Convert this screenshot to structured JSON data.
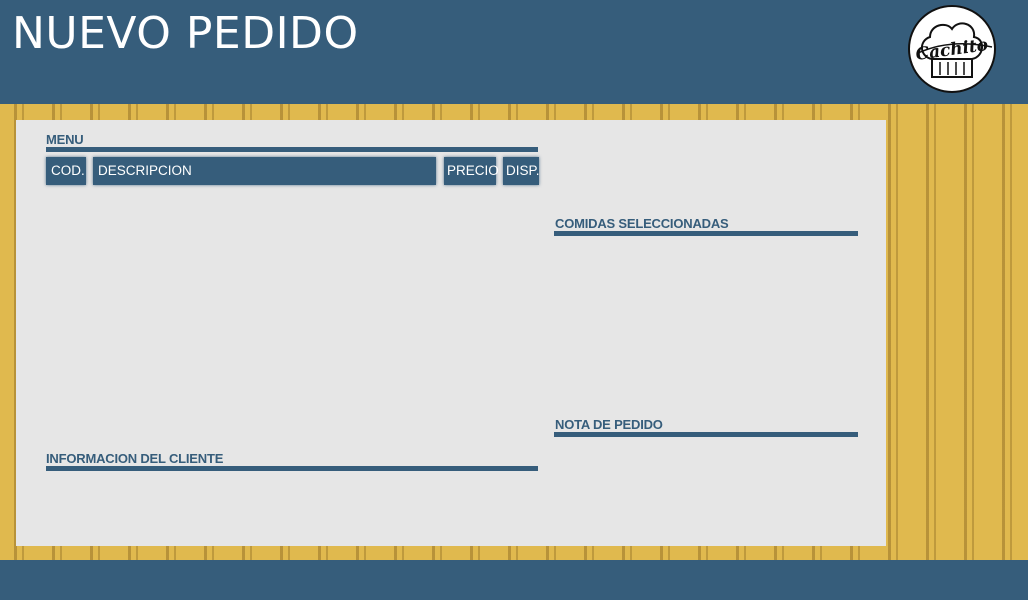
{
  "header": {
    "title": "NUEVO PEDIDO",
    "logo_text": "Cachito"
  },
  "menu": {
    "label": "MENU",
    "columns": [
      "COD.",
      "DESCRIPCION",
      "PRECIO",
      "DISP."
    ]
  },
  "selected": {
    "label": "COMIDAS SELECCIONADAS"
  },
  "note": {
    "label": "NOTA DE PEDIDO"
  },
  "client": {
    "label": "INFORMACION DEL CLIENTE"
  },
  "colors": {
    "primary": "#365d7b",
    "pattern": "#e0b94e",
    "panel": "#e6e6e6"
  },
  "icons": {
    "logo": "chef-hat-logo-icon"
  }
}
